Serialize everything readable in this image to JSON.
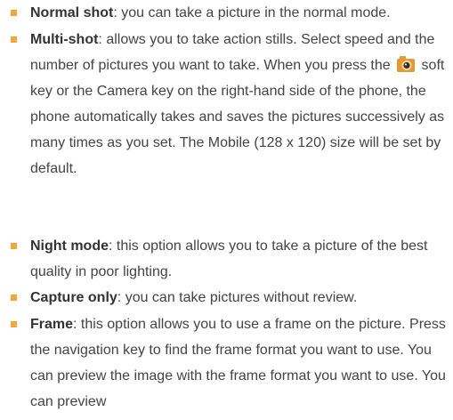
{
  "colors": {
    "bullet": "#f2a73b",
    "text": "#444444",
    "term": "#333333",
    "icon_body": "#e39a33",
    "icon_lens": "#3a2e22"
  },
  "items": [
    {
      "term": "Normal shot",
      "text": ": you can take a picture in the normal mode."
    },
    {
      "term": "Multi-shot",
      "text_before_icon": ": allows you to take action stills. Select speed and the number of pictures you want to take. When you press the",
      "icon": "camera-softkey-icon",
      "text_after_icon": " soft key or the Camera key on the right-hand side of the phone, the phone automatically takes and saves the pictures successively as many times as you set. The Mobile (128 x 120) size will be set by default."
    },
    {
      "term": "Night mode",
      "text": ": this option allows you to take a picture of the best quality in poor lighting."
    },
    {
      "term": "Capture only",
      "text": ": you can take pictures without review."
    },
    {
      "term": "Frame",
      "text": ": this option allows you to use a frame on the picture. Press the navigation key to find the frame format you want to use. You can preview the image with the frame format you want to use. You can preview"
    }
  ]
}
